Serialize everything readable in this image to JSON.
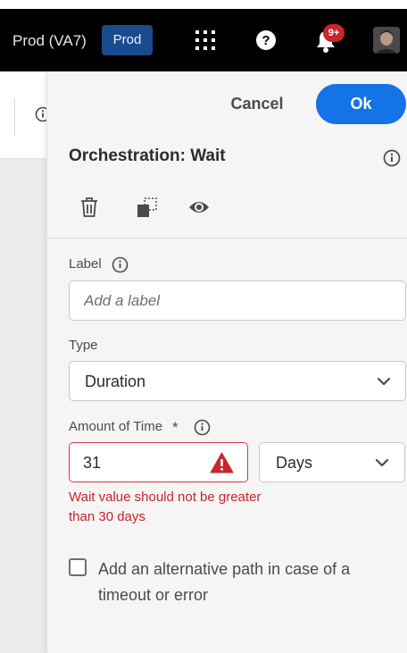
{
  "header": {
    "environment_name": "Prod (VA7)",
    "environment_badge": "Prod",
    "notification_count": "9+",
    "icons": [
      "apps-grid-icon",
      "help-icon",
      "bell-icon",
      "user-avatar"
    ]
  },
  "panel": {
    "cancel_label": "Cancel",
    "ok_label": "Ok",
    "title": "Orchestration: Wait",
    "toolbar_icons": [
      "trash-icon",
      "duplicate-icon",
      "eye-icon"
    ],
    "label_field": {
      "label": "Label",
      "placeholder": "Add a label",
      "value": ""
    },
    "type_field": {
      "label": "Type",
      "selected": "Duration"
    },
    "amount_field": {
      "label": "Amount of Time",
      "required_mark": "*",
      "value": "31",
      "unit_selected": "Days",
      "error": "Wait value should not be greater than 30 days"
    },
    "alt_path_checkbox": {
      "label": "Add an alternative path in case of a timeout or error",
      "checked": false
    }
  },
  "colors": {
    "header_bg": "#000000",
    "accent": "#1473e6",
    "error": "#c9252d",
    "badge": "#1a4b8f",
    "panel_bg": "#f5f5f5"
  }
}
